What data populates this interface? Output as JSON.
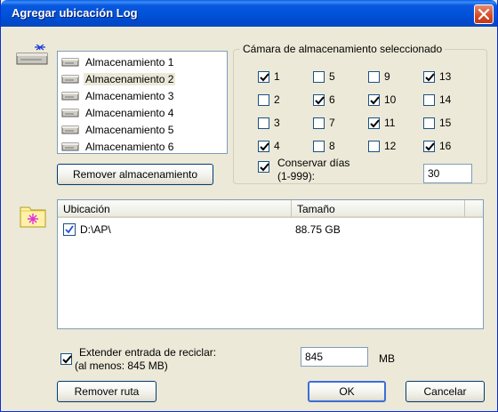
{
  "window": {
    "title": "Agregar ubicación Log"
  },
  "storage": {
    "items": [
      {
        "label": "Almacenamiento 1",
        "selected": false
      },
      {
        "label": "Almacenamiento 2",
        "selected": true
      },
      {
        "label": "Almacenamiento 3",
        "selected": false
      },
      {
        "label": "Almacenamiento 4",
        "selected": false
      },
      {
        "label": "Almacenamiento 5",
        "selected": false
      },
      {
        "label": "Almacenamiento 6",
        "selected": false
      }
    ],
    "remove_button": "Remover almacenamiento"
  },
  "camera_group": {
    "title": "Cámara de almacenamiento seleccionado",
    "cameras": [
      {
        "label": "1",
        "checked": true
      },
      {
        "label": "5",
        "checked": false
      },
      {
        "label": "9",
        "checked": false
      },
      {
        "label": "13",
        "checked": true
      },
      {
        "label": "2",
        "checked": false
      },
      {
        "label": "6",
        "checked": true
      },
      {
        "label": "10",
        "checked": true
      },
      {
        "label": "14",
        "checked": false
      },
      {
        "label": "3",
        "checked": false
      },
      {
        "label": "7",
        "checked": false
      },
      {
        "label": "11",
        "checked": true
      },
      {
        "label": "15",
        "checked": false
      },
      {
        "label": "4",
        "checked": true
      },
      {
        "label": "8",
        "checked": false
      },
      {
        "label": "12",
        "checked": false
      },
      {
        "label": "16",
        "checked": true
      }
    ],
    "keep_days": {
      "label_line1": "Conservar días",
      "label_line2": "(1-999):",
      "checked": true,
      "value": "30"
    }
  },
  "paths_table": {
    "headers": [
      "Ubicación",
      "Tamaño"
    ],
    "rows": [
      {
        "location": "D:\\AP\\",
        "size": "88.75 GB",
        "checked": true
      }
    ]
  },
  "recycle": {
    "label_line1": "Extender entrada de reciclar:",
    "label_line2": "(al menos: 845 MB)",
    "checked": true,
    "value": "845",
    "unit": "MB"
  },
  "buttons": {
    "remove_path": "Remover ruta",
    "ok": "OK",
    "cancel": "Cancelar"
  },
  "colors": {
    "title_bar": "#0052d8",
    "window_bg": "#ece9d8",
    "close_button": "#d54a26"
  }
}
